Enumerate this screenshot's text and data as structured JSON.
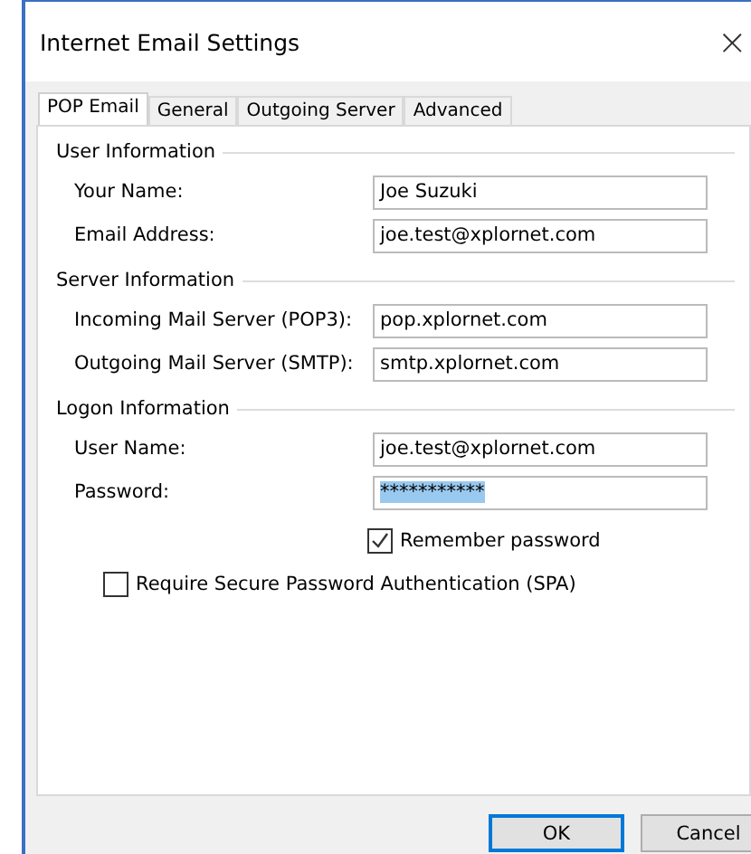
{
  "window": {
    "title": "Internet Email Settings",
    "close": "×"
  },
  "tabs": [
    {
      "label": "POP Email",
      "selected": true
    },
    {
      "label": "General",
      "selected": false
    },
    {
      "label": "Outgoing Server",
      "selected": false
    },
    {
      "label": "Advanced",
      "selected": false
    }
  ],
  "groups": [
    {
      "title": "User Information",
      "fields": [
        {
          "label": "Your Name:",
          "value": "Joe Suzuki"
        },
        {
          "label": "Email Address:",
          "value": "joe.test@xplornet.com"
        }
      ]
    },
    {
      "title": "Server Information",
      "fields": [
        {
          "label": "Incoming Mail Server (POP3):",
          "value": "pop.xplornet.com"
        },
        {
          "label": "Outgoing Mail Server (SMTP):",
          "value": "smtp.xplornet.com"
        }
      ]
    },
    {
      "title": "Logon Information",
      "fields": [
        {
          "label": "User Name:",
          "value": "joe.test@xplornet.com"
        },
        {
          "label": "Password:",
          "value": "***********",
          "highlighted": true
        }
      ]
    }
  ],
  "remember_password": {
    "label": "Remember password",
    "checked": true
  },
  "spa": {
    "label": "Require Secure Password Authentication (SPA)",
    "checked": false
  },
  "buttons": [
    {
      "label": "OK",
      "default": true
    },
    {
      "label": "Cancel",
      "default": false
    }
  ]
}
